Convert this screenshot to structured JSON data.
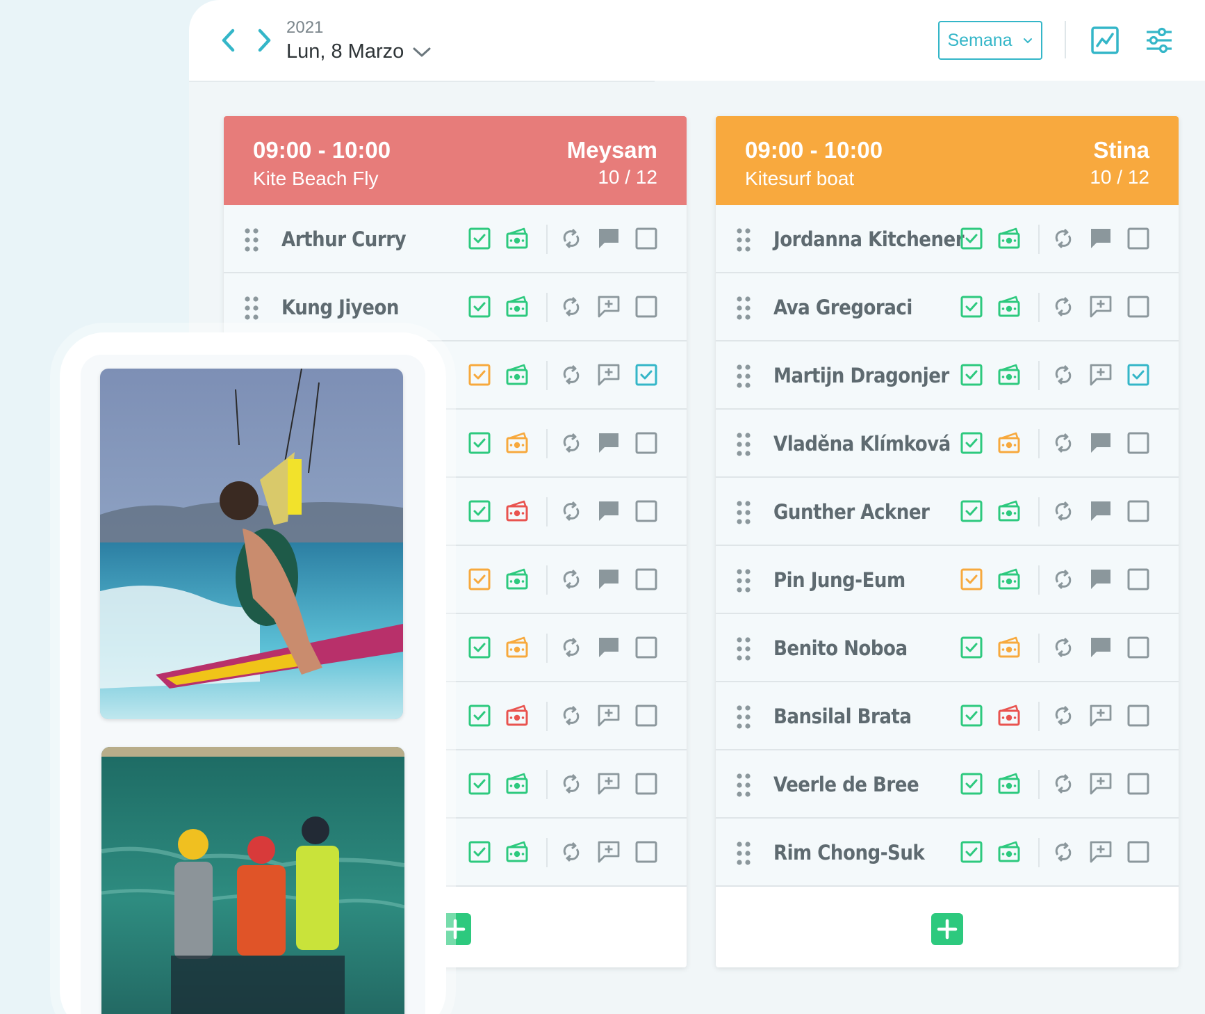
{
  "header": {
    "year": "2021",
    "date": "Lun, 8 Marzo",
    "view_select": "Semana",
    "icons": [
      "chevron-left-icon",
      "chevron-right-icon",
      "chevron-down-icon",
      "chart-icon",
      "sliders-icon"
    ]
  },
  "colors": {
    "accent": "#34b6c8",
    "green": "#2dc97e",
    "orange": "#f7a93d",
    "red": "#e9534f",
    "card1_header": "#e77c7a",
    "card2_header": "#f8a93e",
    "icon_gray": "#8b979c"
  },
  "lessons": [
    {
      "time": "09:00 - 10:00",
      "name": "Kite Beach Fly",
      "instructor": "Meysam",
      "count": "10 / 12",
      "students": [
        {
          "name": "Arthur Curry",
          "check": "green",
          "pay": "green",
          "comment": "filled",
          "selected": false
        },
        {
          "name": "Kung Jiyeon",
          "check": "green",
          "pay": "green",
          "comment": "add",
          "selected": false
        },
        {
          "name": "",
          "check": "orange",
          "pay": "green",
          "comment": "add",
          "selected": true
        },
        {
          "name": "",
          "check": "green",
          "pay": "orange",
          "comment": "filled",
          "selected": false
        },
        {
          "name": "",
          "check": "green",
          "pay": "red",
          "comment": "filled",
          "selected": false
        },
        {
          "name": "",
          "check": "orange",
          "pay": "green",
          "comment": "filled",
          "selected": false
        },
        {
          "name": "",
          "check": "green",
          "pay": "orange",
          "comment": "filled",
          "selected": false
        },
        {
          "name": "",
          "check": "green",
          "pay": "red",
          "comment": "add",
          "selected": false
        },
        {
          "name": "",
          "check": "green",
          "pay": "green",
          "comment": "add",
          "selected": false
        },
        {
          "name": "",
          "check": "green",
          "pay": "green",
          "comment": "add",
          "selected": false
        }
      ]
    },
    {
      "time": "09:00 - 10:00",
      "name": "Kitesurf boat",
      "instructor": "Stina",
      "count": "10 / 12",
      "students": [
        {
          "name": "Jordanna Kitchener",
          "check": "green",
          "pay": "green",
          "comment": "filled",
          "selected": false
        },
        {
          "name": "Ava Gregoraci",
          "check": "green",
          "pay": "green",
          "comment": "add",
          "selected": false
        },
        {
          "name": "Martijn Dragonjer",
          "check": "green",
          "pay": "green",
          "comment": "add",
          "selected": true
        },
        {
          "name": "Vladěna Klímková",
          "check": "green",
          "pay": "orange",
          "comment": "filled",
          "selected": false
        },
        {
          "name": "Gunther Ackner",
          "check": "green",
          "pay": "green",
          "comment": "filled",
          "selected": false
        },
        {
          "name": "Pin Jung-Eum",
          "check": "orange",
          "pay": "green",
          "comment": "filled",
          "selected": false
        },
        {
          "name": "Benito Noboa",
          "check": "green",
          "pay": "orange",
          "comment": "filled",
          "selected": false
        },
        {
          "name": "Bansilal Brata",
          "check": "green",
          "pay": "red",
          "comment": "add",
          "selected": false
        },
        {
          "name": "Veerle de Bree",
          "check": "green",
          "pay": "green",
          "comment": "add",
          "selected": false
        },
        {
          "name": "Rim Chong-Suk",
          "check": "green",
          "pay": "green",
          "comment": "add",
          "selected": false
        }
      ]
    }
  ],
  "phone": {
    "photos": [
      "kitesurfer-photo",
      "kite-lesson-group-photo"
    ]
  }
}
